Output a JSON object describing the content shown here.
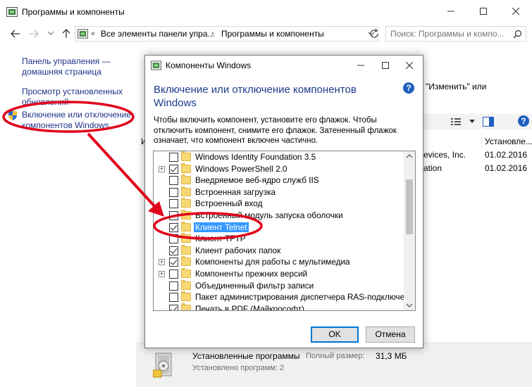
{
  "window": {
    "title": "Программы и компоненты"
  },
  "address": {
    "crumb_1": "Все элементы панели упра...",
    "crumb_2": "Программы и компоненты",
    "search_placeholder": "Поиск: Программы и компо..."
  },
  "sidebar": {
    "home_line1": "Панель управления —",
    "home_line2": "домашняя страница",
    "updates_line1": "Просмотр установленных",
    "updates_line2": "обновлений",
    "features_line1": "Включение или отключение",
    "features_line2": "компонентов Windows"
  },
  "background": {
    "instruction_fragment": "\"Изменить\" или",
    "col_installed": "Установле...",
    "row1_publisher": "evices, Inc.",
    "row1_date": "01.02.2016",
    "row2_publisher": "ation",
    "row2_date": "01.02.2016",
    "col_fragment": "И"
  },
  "status": {
    "installed_programs": "Установленные программы",
    "total_size_label": "Полный размер:",
    "total_size_value": "31,3 МБ",
    "installed_count": "Установлено программ: 2"
  },
  "dialog": {
    "title": "Компоненты Windows",
    "heading_line1": "Включение или отключение компонентов",
    "heading_line2": "Windows",
    "help": "?",
    "desc_line1": "Чтобы включить компонент, установите его флажок. Чтобы",
    "desc_line2": "отключить компонент, снимите его флажок. Затененный флажок",
    "desc_line3": "означает, что компонент включен частично.",
    "items": [
      {
        "label": "Windows Identity Foundation 3.5",
        "checked": false,
        "expandable": false
      },
      {
        "label": "Windows PowerShell 2.0",
        "checked": true,
        "expandable": true
      },
      {
        "label": "Внедряемое веб-ядро служб IIS",
        "checked": false,
        "expandable": false
      },
      {
        "label": "Встроенная загрузка",
        "checked": false,
        "expandable": false
      },
      {
        "label": "Встроенный вход",
        "checked": false,
        "expandable": false
      },
      {
        "label": "Встроенный модуль запуска оболочки",
        "checked": false,
        "expandable": false
      },
      {
        "label": "Клиент Telnet",
        "checked": true,
        "expandable": false,
        "selected": true
      },
      {
        "label": "Клиент TFTP",
        "checked": false,
        "expandable": false
      },
      {
        "label": "Клиент рабочих папок",
        "checked": true,
        "expandable": false
      },
      {
        "label": "Компоненты для работы с мультимедиа",
        "checked": true,
        "expandable": true
      },
      {
        "label": "Компоненты прежних версий",
        "checked": false,
        "expandable": true
      },
      {
        "label": "Объединенный фильтр записи",
        "checked": false,
        "expandable": false
      },
      {
        "label": "Пакет администрирования диспетчера RAS-подключений",
        "checked": false,
        "expandable": false
      },
      {
        "label": "Печать в PDF (Майкрософт)",
        "checked": true,
        "expandable": false
      }
    ],
    "ok_label": "OK",
    "cancel_label": "Отмена"
  },
  "colors": {
    "link": "#1e3287",
    "heading": "#1a3c8b",
    "selection": "#3399ff",
    "annotation": "#e0001a"
  },
  "icons": {
    "app": "control-panel-icon",
    "features": "shield-icon",
    "programs": "installed-programs-icon"
  }
}
